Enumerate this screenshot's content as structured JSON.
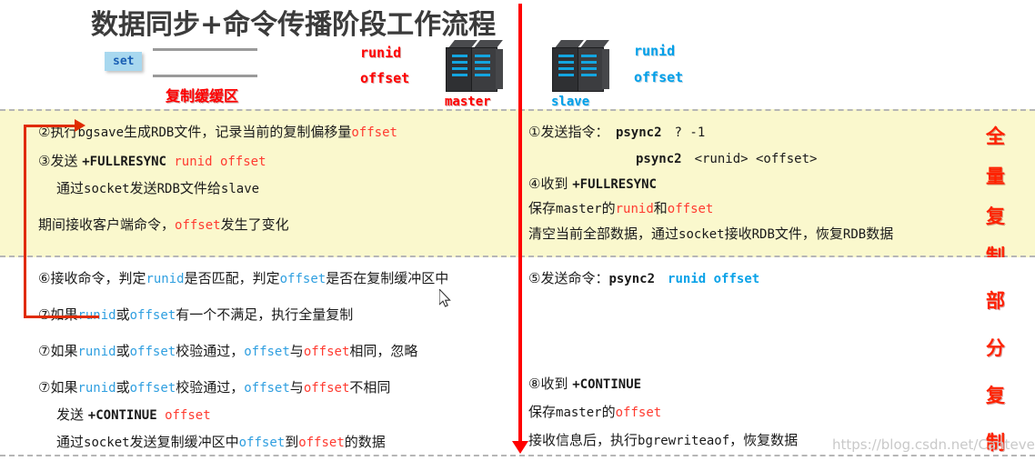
{
  "header": {
    "title": "数据同步+命令传播阶段工作流程",
    "set_badge": "set",
    "buffer_label": "复制缓缓区",
    "master": {
      "name": "master",
      "runid": "runid",
      "offset": "offset"
    },
    "slave": {
      "name": "slave",
      "runid": "runid",
      "offset": "offset"
    }
  },
  "full_sync": {
    "side_label_chars": [
      "全",
      "量",
      "复",
      "制"
    ],
    "left_lines": [
      {
        "segments": [
          {
            "t": "②执行",
            "c": "plain"
          },
          {
            "t": "bgsave",
            "c": "mono"
          },
          {
            "t": "生成",
            "c": "plain"
          },
          {
            "t": "RDB",
            "c": "mono"
          },
          {
            "t": "文件，记录当前的复制偏移量",
            "c": "plain"
          },
          {
            "t": "offset",
            "c": "mono-red"
          }
        ]
      },
      {
        "segments": [
          {
            "t": "③发送 ",
            "c": "plain"
          },
          {
            "t": "+FULLRESYNC ",
            "c": "mono-bold"
          },
          {
            "t": "runid offset",
            "c": "mono-red"
          }
        ]
      },
      {
        "segments": [
          {
            "t": "通过",
            "c": "plain"
          },
          {
            "t": "socket",
            "c": "mono"
          },
          {
            "t": "发送",
            "c": "plain"
          },
          {
            "t": "RDB",
            "c": "mono"
          },
          {
            "t": "文件给",
            "c": "plain"
          },
          {
            "t": "slave",
            "c": "mono"
          }
        ]
      },
      {
        "segments": [
          {
            "t": "期间接收客户端命令，",
            "c": "plain"
          },
          {
            "t": "offset",
            "c": "mono-red"
          },
          {
            "t": "发生了变化",
            "c": "plain"
          }
        ]
      }
    ],
    "right_lines": [
      {
        "segments": [
          {
            "t": "①发送指令：　",
            "c": "plain"
          },
          {
            "t": "psync2",
            "c": "mono-bold"
          },
          {
            "t": "　? -1",
            "c": "mono"
          }
        ]
      },
      {
        "segments": [
          {
            "t": "psync2",
            "c": "mono-bold"
          },
          {
            "t": "　<runid> <offset>",
            "c": "mono"
          }
        ]
      },
      {
        "segments": [
          {
            "t": "④收到 ",
            "c": "plain"
          },
          {
            "t": "+FULLRESYNC",
            "c": "mono-bold"
          }
        ]
      },
      {
        "segments": [
          {
            "t": "保存",
            "c": "plain"
          },
          {
            "t": "master",
            "c": "mono"
          },
          {
            "t": "的",
            "c": "plain"
          },
          {
            "t": "runid",
            "c": "mono-red"
          },
          {
            "t": "和",
            "c": "plain"
          },
          {
            "t": "offset",
            "c": "mono-red"
          }
        ]
      },
      {
        "segments": [
          {
            "t": "清空当前全部数据，通过",
            "c": "plain"
          },
          {
            "t": "socket",
            "c": "mono"
          },
          {
            "t": "接收",
            "c": "plain"
          },
          {
            "t": "RDB",
            "c": "mono"
          },
          {
            "t": "文件，恢复",
            "c": "plain"
          },
          {
            "t": "RDB",
            "c": "mono"
          },
          {
            "t": "数据",
            "c": "plain"
          }
        ]
      }
    ]
  },
  "partial_sync": {
    "side_label_chars": [
      "部",
      "分",
      "复",
      "制"
    ],
    "left_lines": [
      {
        "segments": [
          {
            "t": "⑥接收命令，判定",
            "c": "plain"
          },
          {
            "t": "runid",
            "c": "mono-blue"
          },
          {
            "t": "是否匹配，判定",
            "c": "plain"
          },
          {
            "t": "offset",
            "c": "mono-blue"
          },
          {
            "t": "是否在复制缓冲区中",
            "c": "plain"
          }
        ]
      },
      {
        "segments": [
          {
            "t": "⑦如果",
            "c": "plain"
          },
          {
            "t": "runid",
            "c": "mono-blue"
          },
          {
            "t": "或",
            "c": "plain"
          },
          {
            "t": "offset",
            "c": "mono-blue"
          },
          {
            "t": "有一个不满足，执行全量复制",
            "c": "plain"
          }
        ]
      },
      {
        "segments": [
          {
            "t": "⑦如果",
            "c": "plain"
          },
          {
            "t": "runid",
            "c": "mono-blue"
          },
          {
            "t": "或",
            "c": "plain"
          },
          {
            "t": "offset",
            "c": "mono-blue"
          },
          {
            "t": "校验通过，",
            "c": "plain"
          },
          {
            "t": "offset",
            "c": "mono-blue"
          },
          {
            "t": "与",
            "c": "plain"
          },
          {
            "t": "offset",
            "c": "mono-red"
          },
          {
            "t": "相同，忽略",
            "c": "plain"
          }
        ]
      },
      {
        "segments": [
          {
            "t": "⑦如果",
            "c": "plain"
          },
          {
            "t": "runid",
            "c": "mono-blue"
          },
          {
            "t": "或",
            "c": "plain"
          },
          {
            "t": "offset",
            "c": "mono-blue"
          },
          {
            "t": "校验通过，",
            "c": "plain"
          },
          {
            "t": "offset",
            "c": "mono-blue"
          },
          {
            "t": "与",
            "c": "plain"
          },
          {
            "t": "offset",
            "c": "mono-red"
          },
          {
            "t": "不相同",
            "c": "plain"
          }
        ]
      },
      {
        "segments": [
          {
            "t": "发送 ",
            "c": "plain"
          },
          {
            "t": "+CONTINUE ",
            "c": "mono-bold"
          },
          {
            "t": "offset",
            "c": "mono-red"
          }
        ]
      },
      {
        "segments": [
          {
            "t": "通过",
            "c": "plain"
          },
          {
            "t": "socket",
            "c": "mono"
          },
          {
            "t": "发送复制缓冲区中",
            "c": "plain"
          },
          {
            "t": "offset",
            "c": "mono-blue"
          },
          {
            "t": "到",
            "c": "plain"
          },
          {
            "t": "offset",
            "c": "mono-red"
          },
          {
            "t": "的数据",
            "c": "plain"
          }
        ]
      }
    ],
    "right_lines": [
      {
        "segments": [
          {
            "t": "⑤发送命令：",
            "c": "plain"
          },
          {
            "t": "psync2",
            "c": "mono-bold"
          },
          {
            "t": "　runid offset",
            "c": "mono-blue-bold"
          }
        ]
      },
      {
        "segments": [
          {
            "t": "⑧收到 ",
            "c": "plain"
          },
          {
            "t": "+CONTINUE",
            "c": "mono-bold"
          }
        ]
      },
      {
        "segments": [
          {
            "t": "保存",
            "c": "plain"
          },
          {
            "t": "master",
            "c": "mono"
          },
          {
            "t": "的",
            "c": "plain"
          },
          {
            "t": "offset",
            "c": "mono-red"
          }
        ]
      },
      {
        "segments": [
          {
            "t": "接收信息后，执行",
            "c": "plain"
          },
          {
            "t": "bgrewriteaof",
            "c": "mono"
          },
          {
            "t": "，恢复数据",
            "c": "plain"
          }
        ]
      }
    ]
  },
  "watermark": "https://blog.csdn.net/CantevenI",
  "colors": {
    "yellow_band": "#faf8cd",
    "red": "#ff0000",
    "blue": "#00a0e9",
    "arrow_red": "#e02b00",
    "title_gray": "#3b3b3b"
  }
}
